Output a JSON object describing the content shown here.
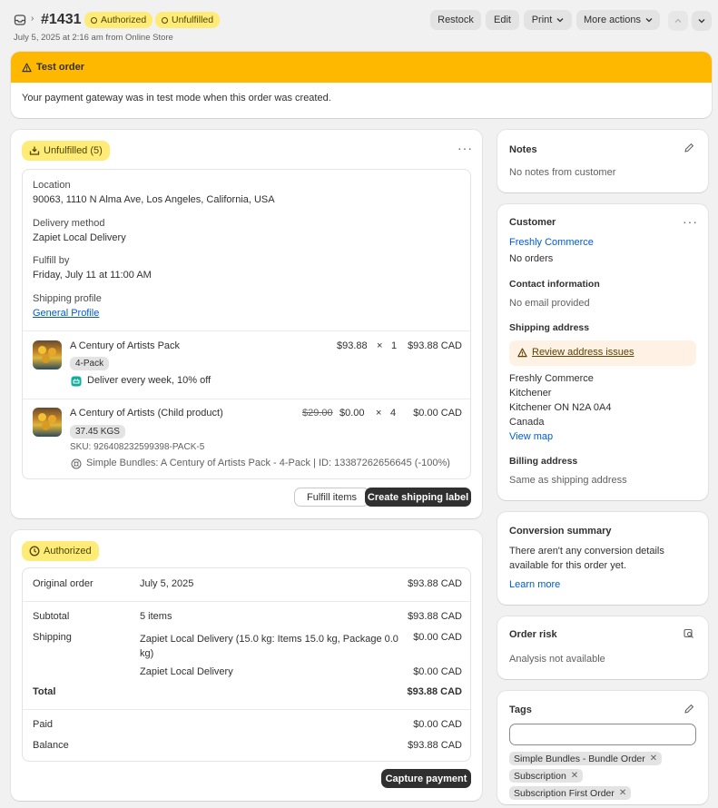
{
  "header": {
    "order_number": "#1431",
    "badge_authorized": "Authorized",
    "badge_unfulfilled": "Unfulfilled",
    "subtitle": "July 5, 2025 at 2:16 am from Online Store",
    "restock": "Restock",
    "edit": "Edit",
    "print": "Print",
    "more_actions": "More actions"
  },
  "test_banner": {
    "title": "Test order",
    "message": "Your payment gateway was in test mode when this order was created."
  },
  "fulfillment": {
    "badge": "Unfulfilled (5)",
    "location_label": "Location",
    "location_value": "90063, 1110 N Alma Ave, Los Angeles, California, USA",
    "delivery_label": "Delivery method",
    "delivery_value": "Zapiet Local Delivery",
    "fulfill_by_label": "Fulfill by",
    "fulfill_by_value": "Friday, July 11 at 11:00 AM",
    "profile_label": "Shipping profile",
    "profile_value": "General Profile",
    "items": [
      {
        "name": "A Century of Artists Pack",
        "variant": "4-Pack",
        "subscription": "Deliver every week, 10% off",
        "price": "$93.88",
        "times": "×",
        "qty": "1",
        "total": "$93.88 CAD"
      },
      {
        "name": "A Century of Artists (Child product)",
        "variant": "37.45 KGS",
        "sku": "SKU: 926408232599398-PACK-5",
        "bundle": "Simple Bundles: A Century of Artists Pack - 4-Pack | ID: 13387262656645 (-100%)",
        "original_price": "$29.00",
        "price": "$0.00",
        "times": "×",
        "qty": "4",
        "total": "$0.00 CAD"
      }
    ],
    "fulfill_btn": "Fulfill items",
    "label_btn": "Create shipping label"
  },
  "payment": {
    "badge": "Authorized",
    "original_order_label": "Original order",
    "original_order_date": "July 5, 2025",
    "original_order_amount": "$93.88 CAD",
    "subtotal_label": "Subtotal",
    "subtotal_items": "5 items",
    "subtotal_amount": "$93.88 CAD",
    "shipping_label": "Shipping",
    "shipping_desc_1": "Zapiet Local Delivery (15.0 kg: Items 15.0 kg, Package 0.0 kg)",
    "shipping_amount_1": "$0.00 CAD",
    "shipping_desc_2": "Zapiet Local Delivery",
    "shipping_amount_2": "$0.00 CAD",
    "total_label": "Total",
    "total_amount": "$93.88 CAD",
    "paid_label": "Paid",
    "paid_amount": "$0.00 CAD",
    "balance_label": "Balance",
    "balance_amount": "$93.88 CAD",
    "capture_btn": "Capture payment"
  },
  "notes": {
    "title": "Notes",
    "text": "No notes from customer"
  },
  "customer": {
    "title": "Customer",
    "name": "Freshly Commerce",
    "orders": "No orders",
    "contact_title": "Contact information",
    "contact_value": "No email provided",
    "shipping_title": "Shipping address",
    "review_link": "Review address issues",
    "address_lines": [
      "Freshly Commerce",
      "Kitchener",
      "Kitchener ON N2A 0A4",
      "Canada"
    ],
    "view_map": "View map",
    "billing_title": "Billing address",
    "billing_value": "Same as shipping address"
  },
  "conversion": {
    "title": "Conversion summary",
    "text": "There aren't any conversion details available for this order yet.",
    "link": "Learn more"
  },
  "risk": {
    "title": "Order risk",
    "text": "Analysis not available"
  },
  "tags": {
    "title": "Tags",
    "input_value": "",
    "items": [
      "Simple Bundles - Bundle Order",
      "Subscription",
      "Subscription First Order"
    ]
  },
  "colors": {
    "banner": "#ffb800",
    "badge_yellow": "#ffeb78",
    "link": "#005bd3",
    "dark_button": "#303030"
  }
}
